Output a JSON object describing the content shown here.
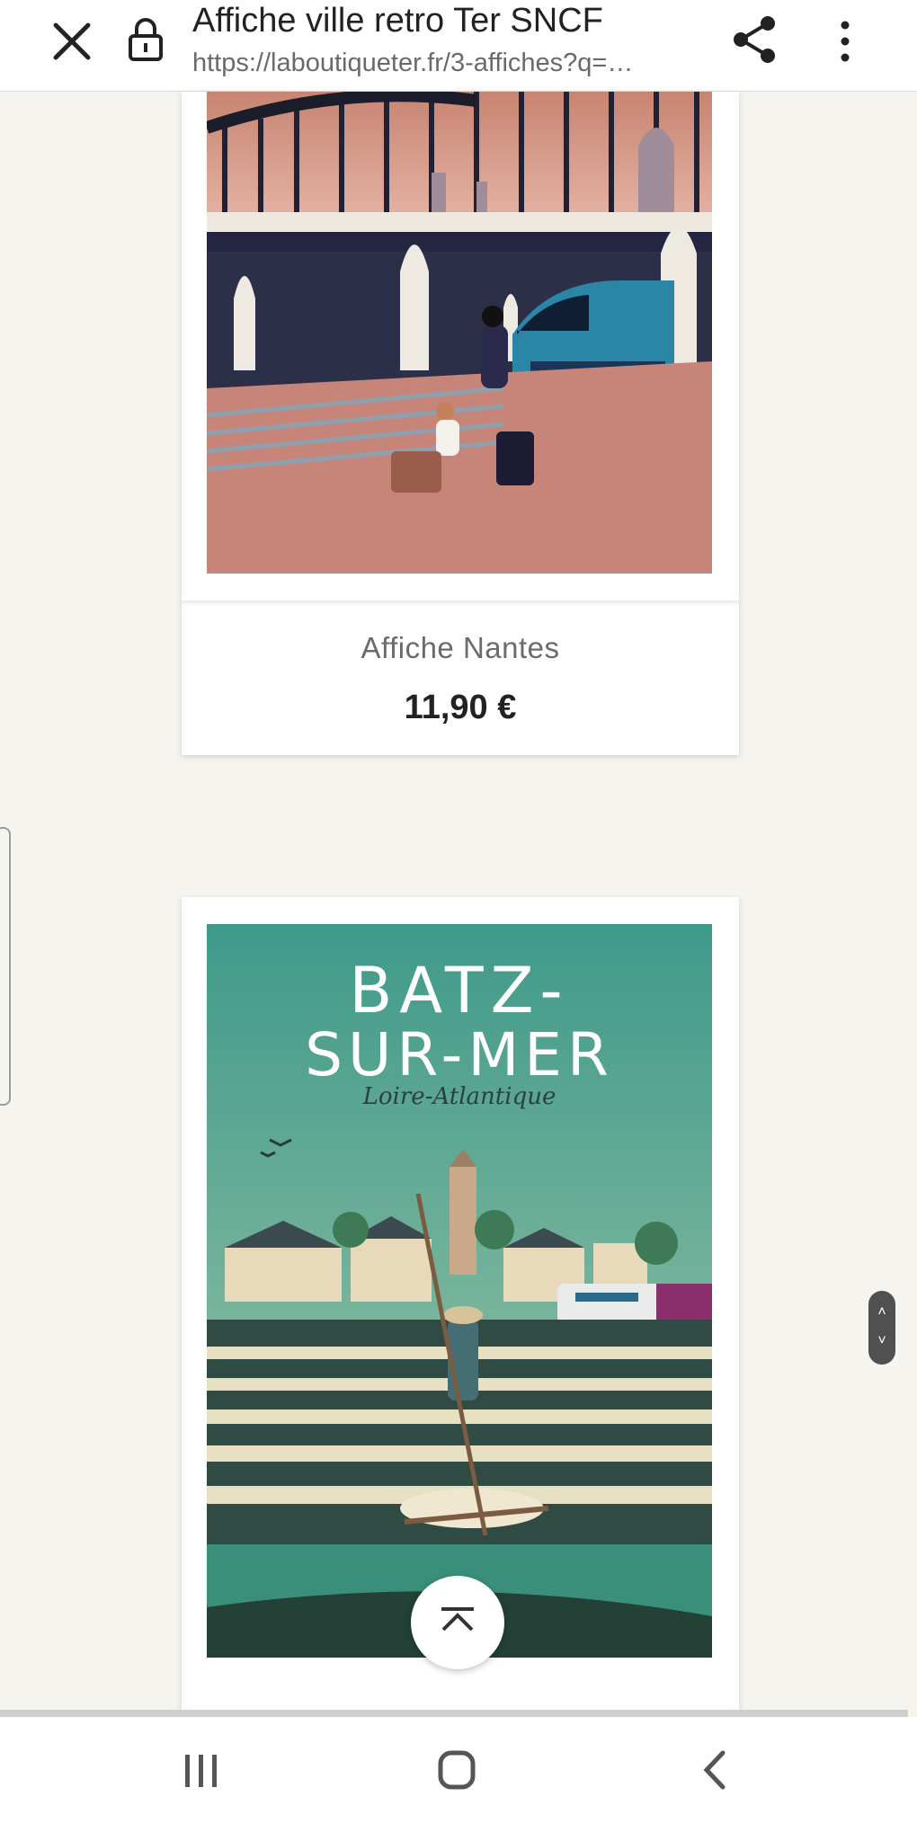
{
  "browser": {
    "title": "Affiche ville retro Ter SNCF",
    "url": "https://laboutiqueter.fr/3-affiches?q=…",
    "icons": {
      "close": "close-icon",
      "lock": "lock-icon",
      "share": "share-icon",
      "more": "more-vert-icon"
    }
  },
  "products": [
    {
      "name": "Affiche Nantes",
      "price": "11,90 €"
    },
    {
      "poster_title_line1": "BATZ-",
      "poster_title_line2": "SUR-MER",
      "poster_subtitle": "Loire-Atlantique"
    }
  ],
  "controls": {
    "back_to_top_icon": "chevron-up-icon",
    "scroll_handle_icons": [
      "chevron-up-icon",
      "chevron-down-icon"
    ]
  },
  "navbar": {
    "icons": [
      "recents-icon",
      "home-icon",
      "back-icon"
    ]
  },
  "colors": {
    "accent_teal": "#3f9a8a",
    "poster_pink": "#c7857a",
    "text_dark": "#222222"
  }
}
